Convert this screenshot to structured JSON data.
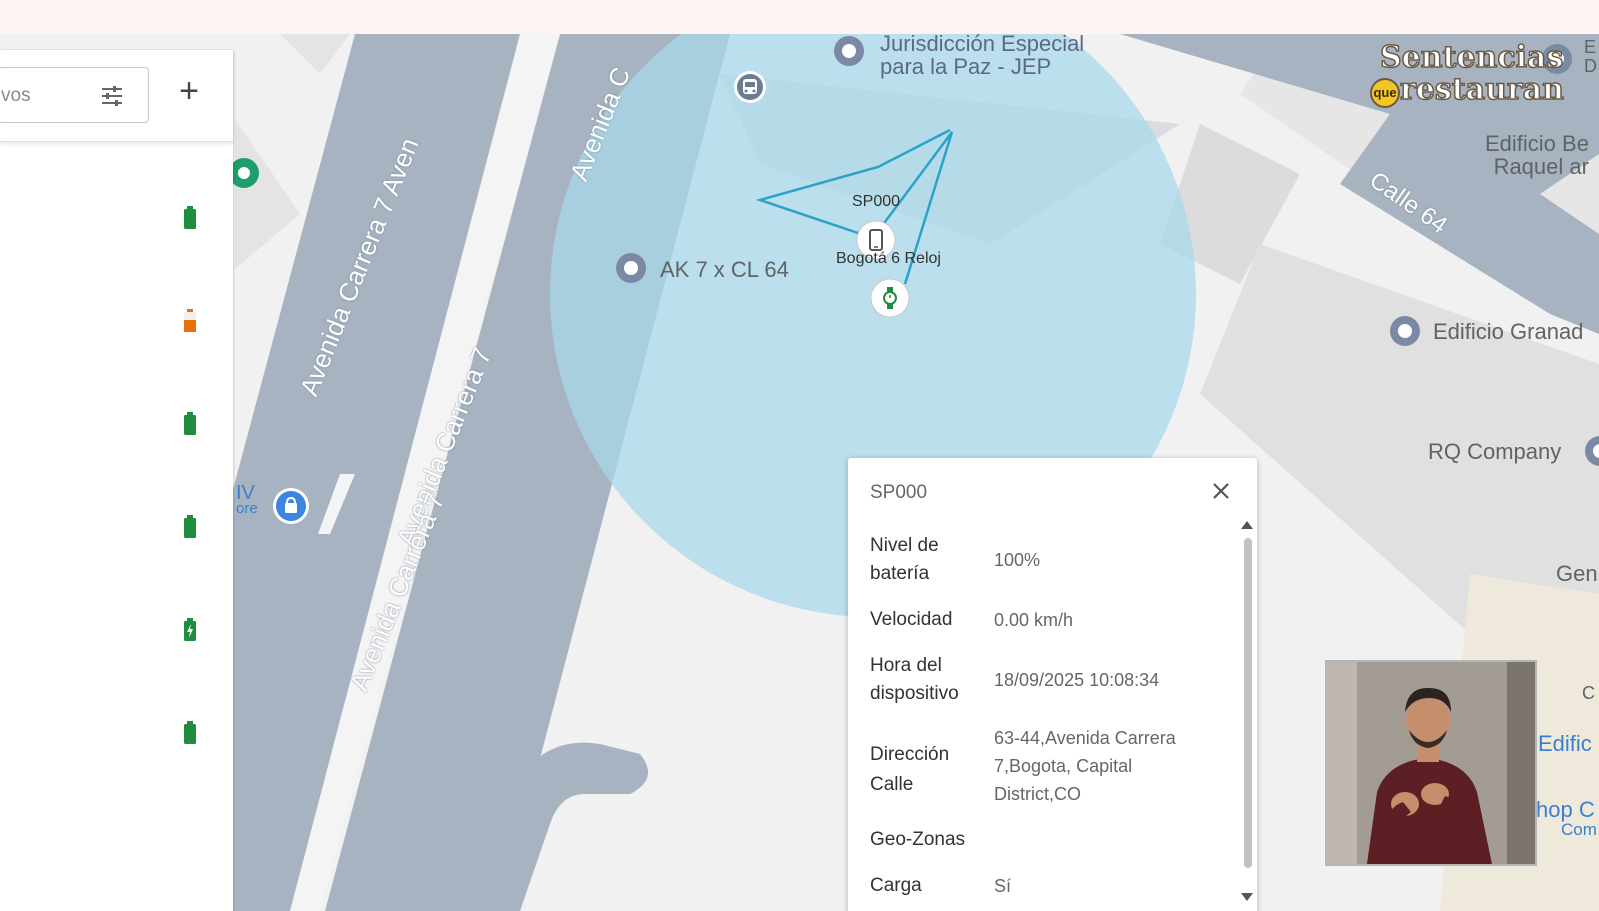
{
  "sidebar": {
    "search_text": "vos",
    "filter_icon": "tune-icon",
    "add_label": "+",
    "batteries": [
      {
        "color": "#1e8e3e",
        "level": 1.0
      },
      {
        "color": "#e8710a",
        "level": 0.3
      },
      {
        "color": "#1e8e3e",
        "level": 1.0
      },
      {
        "color": "#1e8e3e",
        "level": 1.0
      },
      {
        "color": "#1e8e3e",
        "level": 1.0,
        "charging": true
      },
      {
        "color": "#1e8e3e",
        "level": 1.0
      }
    ]
  },
  "map": {
    "labels": {
      "jep_line1": "Jurisdicción Especial",
      "jep_line2": "para la Paz - JEP",
      "ak7": "AK 7 x CL 64",
      "edificio_be_line1": "Edificio Be",
      "edificio_be_line2": "Raquel ar",
      "edificio_granada": "Edificio Granad",
      "rq_company": "RQ Company",
      "gen": "Gen",
      "c": "C",
      "edific": "Edific",
      "hop_line1": "hop C",
      "hop_line2": "Com",
      "e_line1": "E",
      "e_line2": "D",
      "iv_line1": "IV",
      "iv_line2": "ore",
      "device_name": "SP000",
      "device_caption": "Bogotá 6 Reloj"
    },
    "roads": {
      "avenida_c": "Avenida C",
      "avenida_carrera_7_aven": "Avenida Carrera 7 Aven",
      "avenida_carrera_7_a": "Avenida Carrera 7",
      "avenida_carrera_7_b": "Avenida Carrera 7",
      "calle_64": "Calle 64"
    },
    "geofence_color": "#a8d8ea"
  },
  "popup": {
    "title": "SP000",
    "rows": [
      {
        "key_line1": "Nivel de",
        "key_line2": "batería",
        "value": "100%"
      },
      {
        "key": "Velocidad",
        "value": "0.00 km/h"
      },
      {
        "key_line1": "Hora del",
        "key_line2": "dispositivo",
        "value": "18/09/2025 10:08:34"
      },
      {
        "key_line1": "Dirección",
        "key_line2": "Calle",
        "value_line1": "63-44,Avenida Carrera",
        "value_line2": "7,Bogota, Capital",
        "value_line3": "District,CO"
      },
      {
        "key": "Geo-Zonas",
        "value": ""
      },
      {
        "key": "Carga",
        "value": "Sí"
      }
    ]
  },
  "watermark": {
    "line1": "Sentencias",
    "line2_badge": "que",
    "line2": "restauran"
  }
}
